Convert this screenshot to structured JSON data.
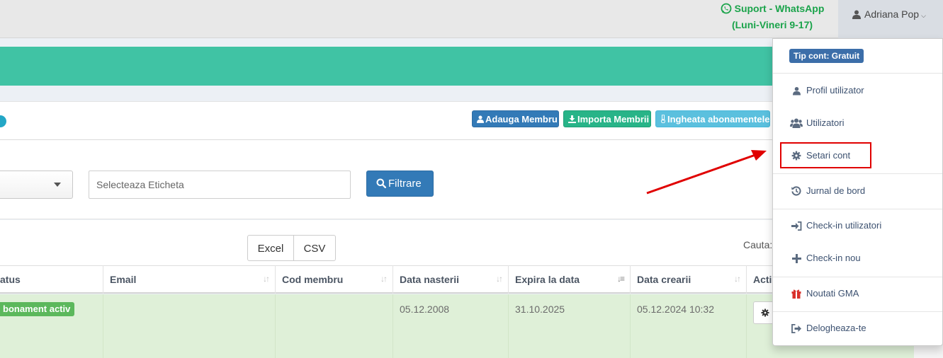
{
  "topbar": {
    "support_line1": "Suport - WhatsApp",
    "support_line2": "(Luni-Vineri 9-17)",
    "user_name": "Adriana Pop",
    "chevron": "⌄",
    "support_color": "#1aa34a"
  },
  "banner": {
    "color": "#40c3a4"
  },
  "toolbar": {
    "add_member": "Adauga Membru",
    "import_members": "Importa Membrii",
    "freeze_subscriptions": "Ingheata abonamentele"
  },
  "filters": {
    "tag_placeholder": "Selecteaza Eticheta",
    "filter_button": "Filtrare"
  },
  "export": {
    "excel": "Excel",
    "csv": "CSV",
    "search_label": "Cauta:"
  },
  "table": {
    "columns": [
      "Status",
      "Email",
      "Cod membru",
      "Data nasterii",
      "Expira la data",
      "Data crearii",
      "Actiuni"
    ],
    "visible_columns": [
      "atus",
      "Email",
      "Cod membru",
      "Data nasterii",
      "Expira la data",
      "Data crearii",
      "Acti"
    ],
    "rows": [
      {
        "status": "Abonament activ",
        "status_visible": "bonament activ",
        "email": "",
        "member_code": "",
        "birth_date": "05.12.2008",
        "expires": "31.10.2025",
        "created": "05.12.2024 10:32"
      }
    ]
  },
  "dropdown": {
    "account_type": "Tip cont: Gratuit",
    "items": [
      {
        "label": "Profil utilizator",
        "icon": "user-icon"
      },
      {
        "label": "Utilizatori",
        "icon": "users-icon"
      },
      {
        "label": "Setari cont",
        "icon": "gear-icon",
        "highlighted": true
      },
      {
        "label": "Jurnal de bord",
        "icon": "history-icon"
      },
      {
        "label": "Check-in utilizatori",
        "icon": "sign-in-icon"
      },
      {
        "label": "Check-in nou",
        "icon": "plus-icon"
      },
      {
        "label": "Noutati GMA",
        "icon": "gift-icon"
      },
      {
        "label": "Delogheaza-te",
        "icon": "sign-out-icon"
      }
    ]
  },
  "colors": {
    "primary": "#337ab7",
    "success": "#28b488",
    "info": "#5bc0de",
    "row_success": "#dff0d8",
    "annotation_red": "#e00000"
  }
}
